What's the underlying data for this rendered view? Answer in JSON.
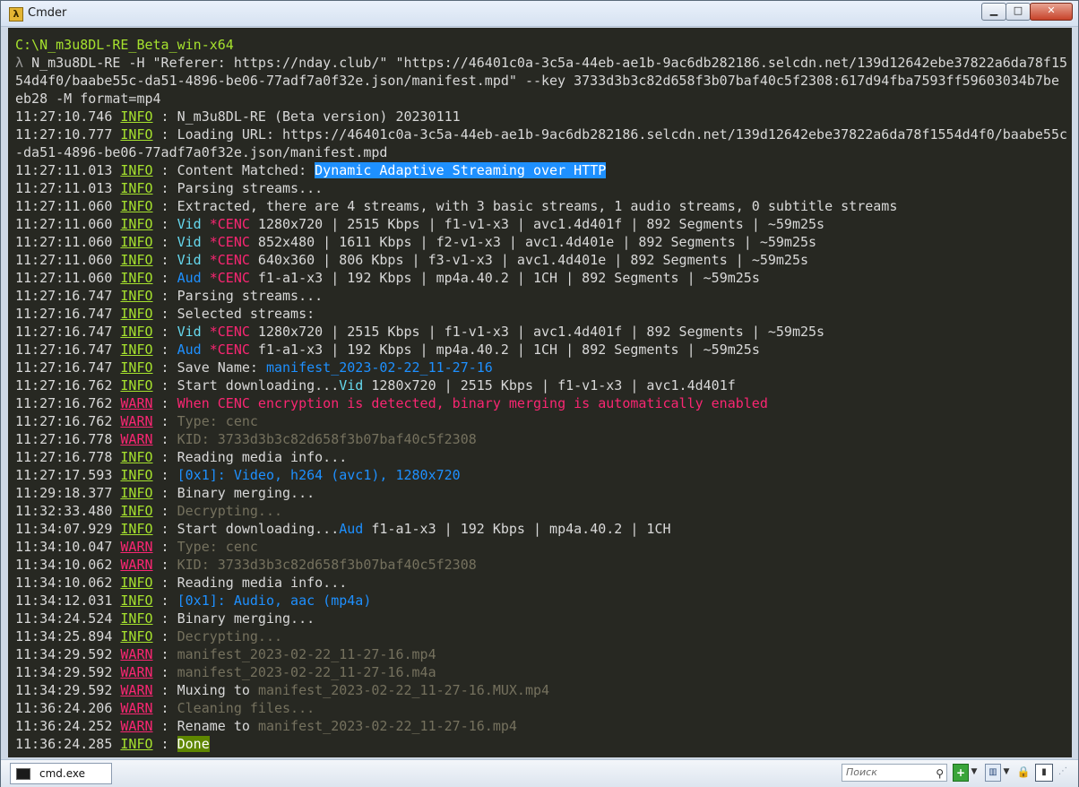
{
  "window": {
    "title": "Cmder",
    "app_icon": "λ",
    "min_label": "▁",
    "max_label": "□",
    "close_label": "✕"
  },
  "console": {
    "lines": [
      [
        {
          "t": "C:\\N_m3u8DL-RE_Beta_win-x64",
          "c": "path"
        }
      ],
      [
        {
          "t": "λ ",
          "c": "lam"
        },
        {
          "t": "N_m3u8DL-RE -H \"Referer: https://nday.club/\" \"https://46401c0a-3c5a-44eb-ae1b-9ac6db282186.selcdn.net/139d12642ebe37822a6da78f15",
          "c": "t-normal"
        }
      ],
      [
        {
          "t": "54d4f0/baabe55c-da51-4896-be06-77adf7a0f32e.json/manifest.mpd\" --key 3733d3b3c82d658f3b07baf40c5f2308:617d94fba7593ff59603034b7be",
          "c": "t-normal"
        }
      ],
      [
        {
          "t": "eb28 -M format=mp4",
          "c": "t-normal"
        }
      ],
      [
        {
          "t": "11:27:10.746 ",
          "c": "ts"
        },
        {
          "t": "INFO",
          "c": "info"
        },
        {
          "t": " : ",
          "c": "sep"
        },
        {
          "t": "N_m3u8DL-RE (Beta version) 20230111",
          "c": "t-normal"
        }
      ],
      [
        {
          "t": "11:27:10.777 ",
          "c": "ts"
        },
        {
          "t": "INFO",
          "c": "info"
        },
        {
          "t": " : ",
          "c": "sep"
        },
        {
          "t": "Loading URL: https://46401c0a-3c5a-44eb-ae1b-9ac6db282186.selcdn.net/139d12642ebe37822a6da78f1554d4f0/baabe55c",
          "c": "t-normal"
        }
      ],
      [
        {
          "t": "-da51-4896-be06-77adf7a0f32e.json/manifest.mpd",
          "c": "t-normal"
        }
      ],
      [
        {
          "t": "11:27:11.013 ",
          "c": "ts"
        },
        {
          "t": "INFO",
          "c": "info"
        },
        {
          "t": " : ",
          "c": "sep"
        },
        {
          "t": "Content Matched: ",
          "c": "t-normal"
        },
        {
          "t": "Dynamic Adaptive Streaming over HTTP",
          "c": "hl"
        }
      ],
      [
        {
          "t": "11:27:11.013 ",
          "c": "ts"
        },
        {
          "t": "INFO",
          "c": "info"
        },
        {
          "t": " : ",
          "c": "sep"
        },
        {
          "t": "Parsing streams...",
          "c": "t-normal"
        }
      ],
      [
        {
          "t": "11:27:11.060 ",
          "c": "ts"
        },
        {
          "t": "INFO",
          "c": "info"
        },
        {
          "t": " : ",
          "c": "sep"
        },
        {
          "t": "Extracted, there are 4 streams, with 3 basic streams, 1 audio streams, 0 subtitle streams",
          "c": "t-normal"
        }
      ],
      [
        {
          "t": "11:27:11.060 ",
          "c": "ts"
        },
        {
          "t": "INFO",
          "c": "info"
        },
        {
          "t": " : ",
          "c": "sep"
        },
        {
          "t": "Vid",
          "c": "t-lblue"
        },
        {
          "t": " ",
          "c": "t-normal"
        },
        {
          "t": "*CENC",
          "c": "t-cenc"
        },
        {
          "t": " 1280x720 | 2515 Kbps | f1-v1-x3 | avc1.4d401f | 892 Segments | ~59m25s",
          "c": "t-normal"
        }
      ],
      [
        {
          "t": "11:27:11.060 ",
          "c": "ts"
        },
        {
          "t": "INFO",
          "c": "info"
        },
        {
          "t": " : ",
          "c": "sep"
        },
        {
          "t": "Vid",
          "c": "t-lblue"
        },
        {
          "t": " ",
          "c": "t-normal"
        },
        {
          "t": "*CENC",
          "c": "t-cenc"
        },
        {
          "t": " 852x480 | 1611 Kbps | f2-v1-x3 | avc1.4d401e | 892 Segments | ~59m25s",
          "c": "t-normal"
        }
      ],
      [
        {
          "t": "11:27:11.060 ",
          "c": "ts"
        },
        {
          "t": "INFO",
          "c": "info"
        },
        {
          "t": " : ",
          "c": "sep"
        },
        {
          "t": "Vid",
          "c": "t-lblue"
        },
        {
          "t": " ",
          "c": "t-normal"
        },
        {
          "t": "*CENC",
          "c": "t-cenc"
        },
        {
          "t": " 640x360 | 806 Kbps | f3-v1-x3 | avc1.4d401e | 892 Segments | ~59m25s",
          "c": "t-normal"
        }
      ],
      [
        {
          "t": "11:27:11.060 ",
          "c": "ts"
        },
        {
          "t": "INFO",
          "c": "info"
        },
        {
          "t": " : ",
          "c": "sep"
        },
        {
          "t": "Aud",
          "c": "t-blue"
        },
        {
          "t": " ",
          "c": "t-normal"
        },
        {
          "t": "*CENC",
          "c": "t-cenc"
        },
        {
          "t": " f1-a1-x3 | 192 Kbps | mp4a.40.2 | 1CH | 892 Segments | ~59m25s",
          "c": "t-normal"
        }
      ],
      [
        {
          "t": "11:27:16.747 ",
          "c": "ts"
        },
        {
          "t": "INFO",
          "c": "info"
        },
        {
          "t": " : ",
          "c": "sep"
        },
        {
          "t": "Parsing streams...",
          "c": "t-normal"
        }
      ],
      [
        {
          "t": "11:27:16.747 ",
          "c": "ts"
        },
        {
          "t": "INFO",
          "c": "info"
        },
        {
          "t": " : ",
          "c": "sep"
        },
        {
          "t": "Selected streams:",
          "c": "t-normal"
        }
      ],
      [
        {
          "t": "11:27:16.747 ",
          "c": "ts"
        },
        {
          "t": "INFO",
          "c": "info"
        },
        {
          "t": " : ",
          "c": "sep"
        },
        {
          "t": "Vid",
          "c": "t-lblue"
        },
        {
          "t": " ",
          "c": "t-normal"
        },
        {
          "t": "*CENC",
          "c": "t-cenc"
        },
        {
          "t": " 1280x720 | 2515 Kbps | f1-v1-x3 | avc1.4d401f | 892 Segments | ~59m25s",
          "c": "t-normal"
        }
      ],
      [
        {
          "t": "11:27:16.747 ",
          "c": "ts"
        },
        {
          "t": "INFO",
          "c": "info"
        },
        {
          "t": " : ",
          "c": "sep"
        },
        {
          "t": "Aud",
          "c": "t-blue"
        },
        {
          "t": " ",
          "c": "t-normal"
        },
        {
          "t": "*CENC",
          "c": "t-cenc"
        },
        {
          "t": " f1-a1-x3 | 192 Kbps | mp4a.40.2 | 1CH | 892 Segments | ~59m25s",
          "c": "t-normal"
        }
      ],
      [
        {
          "t": "11:27:16.747 ",
          "c": "ts"
        },
        {
          "t": "INFO",
          "c": "info"
        },
        {
          "t": " : ",
          "c": "sep"
        },
        {
          "t": "Save Name: ",
          "c": "t-normal"
        },
        {
          "t": "manifest_2023-02-22_11-27-16",
          "c": "t-blue"
        }
      ],
      [
        {
          "t": "11:27:16.762 ",
          "c": "ts"
        },
        {
          "t": "INFO",
          "c": "info"
        },
        {
          "t": " : ",
          "c": "sep"
        },
        {
          "t": "Start downloading...",
          "c": "t-normal"
        },
        {
          "t": "Vid",
          "c": "t-lblue"
        },
        {
          "t": " 1280x720 | 2515 Kbps | f1-v1-x3 | avc1.4d401f",
          "c": "t-normal"
        }
      ],
      [
        {
          "t": "11:27:16.762 ",
          "c": "ts"
        },
        {
          "t": "WARN",
          "c": "warn"
        },
        {
          "t": " : ",
          "c": "sep"
        },
        {
          "t": "When CENC encryption is detected, binary merging is automatically enabled",
          "c": "t-red"
        }
      ],
      [
        {
          "t": "11:27:16.762 ",
          "c": "ts"
        },
        {
          "t": "WARN",
          "c": "warn"
        },
        {
          "t": " : ",
          "c": "sep"
        },
        {
          "t": "Type: cenc",
          "c": "t-gray"
        }
      ],
      [
        {
          "t": "11:27:16.778 ",
          "c": "ts"
        },
        {
          "t": "WARN",
          "c": "warn"
        },
        {
          "t": " : ",
          "c": "sep"
        },
        {
          "t": "KID: 3733d3b3c82d658f3b07baf40c5f2308",
          "c": "t-gray"
        }
      ],
      [
        {
          "t": "11:27:16.778 ",
          "c": "ts"
        },
        {
          "t": "INFO",
          "c": "info"
        },
        {
          "t": " : ",
          "c": "sep"
        },
        {
          "t": "Reading media info...",
          "c": "t-normal"
        }
      ],
      [
        {
          "t": "11:27:17.593 ",
          "c": "ts"
        },
        {
          "t": "INFO",
          "c": "info"
        },
        {
          "t": " : ",
          "c": "sep"
        },
        {
          "t": "[0x1]: Video, h264 (avc1), 1280x720",
          "c": "t-blue"
        }
      ],
      [
        {
          "t": "11:29:18.377 ",
          "c": "ts"
        },
        {
          "t": "INFO",
          "c": "info"
        },
        {
          "t": " : ",
          "c": "sep"
        },
        {
          "t": "Binary merging...",
          "c": "t-normal"
        }
      ],
      [
        {
          "t": "11:32:33.480 ",
          "c": "ts"
        },
        {
          "t": "INFO",
          "c": "info"
        },
        {
          "t": " : ",
          "c": "sep"
        },
        {
          "t": "Decrypting...",
          "c": "t-gray"
        }
      ],
      [
        {
          "t": "11:34:07.929 ",
          "c": "ts"
        },
        {
          "t": "INFO",
          "c": "info"
        },
        {
          "t": " : ",
          "c": "sep"
        },
        {
          "t": "Start downloading...",
          "c": "t-normal"
        },
        {
          "t": "Aud",
          "c": "t-blue"
        },
        {
          "t": " f1-a1-x3 | 192 Kbps | mp4a.40.2 | 1CH",
          "c": "t-normal"
        }
      ],
      [
        {
          "t": "11:34:10.047 ",
          "c": "ts"
        },
        {
          "t": "WARN",
          "c": "warn"
        },
        {
          "t": " : ",
          "c": "sep"
        },
        {
          "t": "Type: cenc",
          "c": "t-gray"
        }
      ],
      [
        {
          "t": "11:34:10.062 ",
          "c": "ts"
        },
        {
          "t": "WARN",
          "c": "warn"
        },
        {
          "t": " : ",
          "c": "sep"
        },
        {
          "t": "KID: 3733d3b3c82d658f3b07baf40c5f2308",
          "c": "t-gray"
        }
      ],
      [
        {
          "t": "11:34:10.062 ",
          "c": "ts"
        },
        {
          "t": "INFO",
          "c": "info"
        },
        {
          "t": " : ",
          "c": "sep"
        },
        {
          "t": "Reading media info...",
          "c": "t-normal"
        }
      ],
      [
        {
          "t": "11:34:12.031 ",
          "c": "ts"
        },
        {
          "t": "INFO",
          "c": "info"
        },
        {
          "t": " : ",
          "c": "sep"
        },
        {
          "t": "[0x1]: Audio, aac (mp4a)",
          "c": "t-blue"
        }
      ],
      [
        {
          "t": "11:34:24.524 ",
          "c": "ts"
        },
        {
          "t": "INFO",
          "c": "info"
        },
        {
          "t": " : ",
          "c": "sep"
        },
        {
          "t": "Binary merging...",
          "c": "t-normal"
        }
      ],
      [
        {
          "t": "11:34:25.894 ",
          "c": "ts"
        },
        {
          "t": "INFO",
          "c": "info"
        },
        {
          "t": " : ",
          "c": "sep"
        },
        {
          "t": "Decrypting...",
          "c": "t-gray"
        }
      ],
      [
        {
          "t": "11:34:29.592 ",
          "c": "ts"
        },
        {
          "t": "WARN",
          "c": "warn"
        },
        {
          "t": " : ",
          "c": "sep"
        },
        {
          "t": "manifest_2023-02-22_11-27-16.mp4",
          "c": "t-gray"
        }
      ],
      [
        {
          "t": "11:34:29.592 ",
          "c": "ts"
        },
        {
          "t": "WARN",
          "c": "warn"
        },
        {
          "t": " : ",
          "c": "sep"
        },
        {
          "t": "manifest_2023-02-22_11-27-16.m4a",
          "c": "t-gray"
        }
      ],
      [
        {
          "t": "11:34:29.592 ",
          "c": "ts"
        },
        {
          "t": "WARN",
          "c": "warn"
        },
        {
          "t": " : ",
          "c": "sep"
        },
        {
          "t": "Muxing to ",
          "c": "t-normal"
        },
        {
          "t": "manifest_2023-02-22_11-27-16.MUX.mp4",
          "c": "t-gray"
        }
      ],
      [
        {
          "t": "11:36:24.206 ",
          "c": "ts"
        },
        {
          "t": "WARN",
          "c": "warn"
        },
        {
          "t": " : ",
          "c": "sep"
        },
        {
          "t": "Cleaning files...",
          "c": "t-gray"
        }
      ],
      [
        {
          "t": "11:36:24.252 ",
          "c": "ts"
        },
        {
          "t": "WARN",
          "c": "warn"
        },
        {
          "t": " : ",
          "c": "sep"
        },
        {
          "t": "Rename to ",
          "c": "t-normal"
        },
        {
          "t": "manifest_2023-02-22_11-27-16.mp4",
          "c": "t-gray"
        }
      ],
      [
        {
          "t": "11:36:24.285 ",
          "c": "ts"
        },
        {
          "t": "INFO",
          "c": "info"
        },
        {
          "t": " : ",
          "c": "sep"
        },
        {
          "t": "Done",
          "c": "done"
        }
      ]
    ]
  },
  "statusbar": {
    "tab_label": "cmd.exe",
    "search_placeholder": "Поиск",
    "search_icon": "⚲",
    "add_icon": "+",
    "dropdown_icon": "▼",
    "window_icon": "▥",
    "lock_icon": "🔒",
    "panel_icon": "▮",
    "grip_icon": "⋰"
  }
}
